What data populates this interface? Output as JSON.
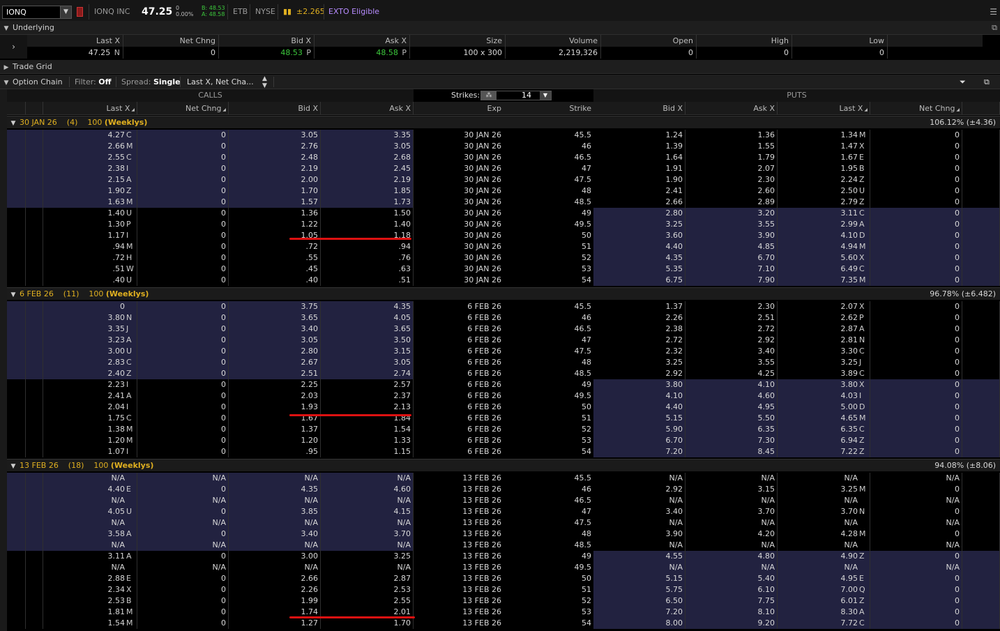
{
  "topbar": {
    "symbol": "IONQ",
    "name": "IONQ INC",
    "price": "47.25",
    "net_change": "0",
    "pct_change": "0.00%",
    "bid": "B: 48.53",
    "ask": "A: 48.58",
    "etb": "ETB",
    "exchange": "NYSE",
    "market_maker_move": "±2.265",
    "exto": "EXTO Eligible"
  },
  "underlying": {
    "title": "Underlying",
    "headers": [
      "Last X",
      "Net Chng",
      "Bid X",
      "Ask X",
      "Size",
      "Volume",
      "Open",
      "High",
      "Low"
    ],
    "last": "47.25",
    "last_ex": "N",
    "net_chng": "0",
    "bid": "48.53",
    "bid_ex": "P",
    "ask": "48.58",
    "ask_ex": "P",
    "size": "100 x 300",
    "volume": "2,219,326",
    "open": "0",
    "high": "0",
    "low": "0"
  },
  "trade_grid": {
    "title": "Trade Grid"
  },
  "option_chain": {
    "title": "Option Chain",
    "filter_label": "Filter:",
    "filter_value": "Off",
    "spread_label": "Spread:",
    "spread_value": "Single",
    "layout": "Last X, Net Cha...",
    "calls_label": "CALLS",
    "puts_label": "PUTS",
    "strikes_label": "Strikes:",
    "strikes_value": "14",
    "call_headers": [
      "Last X",
      "Net Chng",
      "Bid X",
      "Ask X"
    ],
    "mid_headers": [
      "Exp",
      "Strike"
    ],
    "put_headers": [
      "Bid X",
      "Ask X",
      "Last X",
      "Net Chng"
    ]
  },
  "groups": [
    {
      "exp": "30 JAN 26",
      "days": "(4)",
      "mult": "100",
      "tag": "(Weeklys)",
      "iv": "106.12% (±4.36)",
      "rows": [
        {
          "cl": "4.27",
          "cle": "C",
          "cn": "0",
          "cb": "3.05",
          "ca": "3.35",
          "k": "45.5",
          "pb": "1.24",
          "pa": "1.36",
          "pl": "1.34",
          "ple": "M",
          "pn": "0"
        },
        {
          "cl": "2.66",
          "cle": "M",
          "cn": "0",
          "cb": "2.76",
          "ca": "3.05",
          "k": "46",
          "pb": "1.39",
          "pa": "1.55",
          "pl": "1.47",
          "ple": "X",
          "pn": "0"
        },
        {
          "cl": "2.55",
          "cle": "C",
          "cn": "0",
          "cb": "2.48",
          "ca": "2.68",
          "k": "46.5",
          "pb": "1.64",
          "pa": "1.79",
          "pl": "1.67",
          "ple": "E",
          "pn": "0"
        },
        {
          "cl": "2.38",
          "cle": "I",
          "cn": "0",
          "cb": "2.19",
          "ca": "2.45",
          "k": "47",
          "pb": "1.91",
          "pa": "2.07",
          "pl": "1.95",
          "ple": "B",
          "pn": "0"
        },
        {
          "cl": "2.15",
          "cle": "A",
          "cn": "0",
          "cb": "2.00",
          "ca": "2.19",
          "k": "47.5",
          "pb": "1.90",
          "pa": "2.30",
          "pl": "2.24",
          "ple": "Z",
          "pn": "0"
        },
        {
          "cl": "1.90",
          "cle": "Z",
          "cn": "0",
          "cb": "1.70",
          "ca": "1.85",
          "k": "48",
          "pb": "2.41",
          "pa": "2.60",
          "pl": "2.50",
          "ple": "U",
          "pn": "0"
        },
        {
          "cl": "1.63",
          "cle": "M",
          "cn": "0",
          "cb": "1.57",
          "ca": "1.73",
          "k": "48.5",
          "pb": "2.66",
          "pa": "2.89",
          "pl": "2.79",
          "ple": "Z",
          "pn": "0"
        },
        {
          "cl": "1.40",
          "cle": "U",
          "cn": "0",
          "cb": "1.36",
          "ca": "1.50",
          "k": "49",
          "pb": "2.80",
          "pa": "3.20",
          "pl": "3.11",
          "ple": "C",
          "pn": "0"
        },
        {
          "cl": "1.30",
          "cle": "P",
          "cn": "0",
          "cb": "1.22",
          "ca": "1.40",
          "k": "49.5",
          "pb": "3.25",
          "pa": "3.55",
          "pl": "2.99",
          "ple": "A",
          "pn": "0"
        },
        {
          "cl": "1.17",
          "cle": "I",
          "cn": "0",
          "cb": "1.05",
          "ca": "1.18",
          "k": "50",
          "pb": "3.60",
          "pa": "3.90",
          "pl": "4.10",
          "ple": "D",
          "pn": "0"
        },
        {
          "cl": ".94",
          "cle": "M",
          "cn": "0",
          "cb": ".72",
          "ca": ".94",
          "k": "51",
          "pb": "4.40",
          "pa": "4.85",
          "pl": "4.94",
          "ple": "M",
          "pn": "0"
        },
        {
          "cl": ".72",
          "cle": "H",
          "cn": "0",
          "cb": ".55",
          "ca": ".76",
          "k": "52",
          "pb": "4.35",
          "pa": "6.70",
          "pl": "5.60",
          "ple": "X",
          "pn": "0"
        },
        {
          "cl": ".51",
          "cle": "W",
          "cn": "0",
          "cb": ".45",
          "ca": ".63",
          "k": "53",
          "pb": "5.35",
          "pa": "7.10",
          "pl": "6.49",
          "ple": "C",
          "pn": "0"
        },
        {
          "cl": ".40",
          "cle": "U",
          "cn": "0",
          "cb": ".40",
          "ca": ".51",
          "k": "54",
          "pb": "6.75",
          "pa": "7.90",
          "pl": "7.35",
          "ple": "M",
          "pn": "0"
        }
      ]
    },
    {
      "exp": "6 FEB 26",
      "days": "(11)",
      "mult": "100",
      "tag": "(Weeklys)",
      "iv": "96.78% (±6.482)",
      "rows": [
        {
          "cl": "0",
          "cle": "",
          "cn": "0",
          "cb": "3.75",
          "ca": "4.35",
          "k": "45.5",
          "pb": "1.37",
          "pa": "2.30",
          "pl": "2.07",
          "ple": "X",
          "pn": "0"
        },
        {
          "cl": "3.80",
          "cle": "N",
          "cn": "0",
          "cb": "3.65",
          "ca": "4.05",
          "k": "46",
          "pb": "2.26",
          "pa": "2.51",
          "pl": "2.62",
          "ple": "P",
          "pn": "0"
        },
        {
          "cl": "3.35",
          "cle": "J",
          "cn": "0",
          "cb": "3.40",
          "ca": "3.65",
          "k": "46.5",
          "pb": "2.38",
          "pa": "2.72",
          "pl": "2.87",
          "ple": "A",
          "pn": "0"
        },
        {
          "cl": "3.23",
          "cle": "A",
          "cn": "0",
          "cb": "3.05",
          "ca": "3.50",
          "k": "47",
          "pb": "2.72",
          "pa": "2.92",
          "pl": "2.81",
          "ple": "N",
          "pn": "0"
        },
        {
          "cl": "3.00",
          "cle": "U",
          "cn": "0",
          "cb": "2.80",
          "ca": "3.15",
          "k": "47.5",
          "pb": "2.32",
          "pa": "3.40",
          "pl": "3.30",
          "ple": "C",
          "pn": "0"
        },
        {
          "cl": "2.83",
          "cle": "C",
          "cn": "0",
          "cb": "2.67",
          "ca": "3.05",
          "k": "48",
          "pb": "3.25",
          "pa": "3.55",
          "pl": "3.25",
          "ple": "J",
          "pn": "0"
        },
        {
          "cl": "2.40",
          "cle": "Z",
          "cn": "0",
          "cb": "2.51",
          "ca": "2.74",
          "k": "48.5",
          "pb": "2.92",
          "pa": "4.25",
          "pl": "3.89",
          "ple": "C",
          "pn": "0"
        },
        {
          "cl": "2.23",
          "cle": "I",
          "cn": "0",
          "cb": "2.25",
          "ca": "2.57",
          "k": "49",
          "pb": "3.80",
          "pa": "4.10",
          "pl": "3.80",
          "ple": "X",
          "pn": "0"
        },
        {
          "cl": "2.41",
          "cle": "A",
          "cn": "0",
          "cb": "2.03",
          "ca": "2.37",
          "k": "49.5",
          "pb": "4.10",
          "pa": "4.60",
          "pl": "4.03",
          "ple": "I",
          "pn": "0"
        },
        {
          "cl": "2.04",
          "cle": "I",
          "cn": "0",
          "cb": "1.93",
          "ca": "2.13",
          "k": "50",
          "pb": "4.40",
          "pa": "4.95",
          "pl": "5.00",
          "ple": "D",
          "pn": "0"
        },
        {
          "cl": "1.75",
          "cle": "C",
          "cn": "0",
          "cb": "1.67",
          "ca": "1.84",
          "k": "51",
          "pb": "5.15",
          "pa": "5.50",
          "pl": "4.65",
          "ple": "M",
          "pn": "0"
        },
        {
          "cl": "1.38",
          "cle": "M",
          "cn": "0",
          "cb": "1.37",
          "ca": "1.54",
          "k": "52",
          "pb": "5.90",
          "pa": "6.35",
          "pl": "6.35",
          "ple": "C",
          "pn": "0"
        },
        {
          "cl": "1.20",
          "cle": "M",
          "cn": "0",
          "cb": "1.20",
          "ca": "1.33",
          "k": "53",
          "pb": "6.70",
          "pa": "7.30",
          "pl": "6.94",
          "ple": "Z",
          "pn": "0"
        },
        {
          "cl": "1.07",
          "cle": "I",
          "cn": "0",
          "cb": ".95",
          "ca": "1.15",
          "k": "54",
          "pb": "7.20",
          "pa": "8.45",
          "pl": "7.22",
          "ple": "Z",
          "pn": "0"
        }
      ]
    },
    {
      "exp": "13 FEB 26",
      "days": "(18)",
      "mult": "100",
      "tag": "(Weeklys)",
      "iv": "94.08% (±8.06)",
      "rows": [
        {
          "cl": "N/A",
          "cle": "",
          "cn": "N/A",
          "cb": "N/A",
          "ca": "N/A",
          "k": "45.5",
          "pb": "N/A",
          "pa": "N/A",
          "pl": "N/A",
          "ple": "",
          "pn": "N/A"
        },
        {
          "cl": "4.40",
          "cle": "E",
          "cn": "0",
          "cb": "4.35",
          "ca": "4.60",
          "k": "46",
          "pb": "2.92",
          "pa": "3.15",
          "pl": "3.25",
          "ple": "M",
          "pn": "0"
        },
        {
          "cl": "N/A",
          "cle": "",
          "cn": "N/A",
          "cb": "N/A",
          "ca": "N/A",
          "k": "46.5",
          "pb": "N/A",
          "pa": "N/A",
          "pl": "N/A",
          "ple": "",
          "pn": "N/A"
        },
        {
          "cl": "4.05",
          "cle": "U",
          "cn": "0",
          "cb": "3.85",
          "ca": "4.15",
          "k": "47",
          "pb": "3.40",
          "pa": "3.70",
          "pl": "3.70",
          "ple": "N",
          "pn": "0"
        },
        {
          "cl": "N/A",
          "cle": "",
          "cn": "N/A",
          "cb": "N/A",
          "ca": "N/A",
          "k": "47.5",
          "pb": "N/A",
          "pa": "N/A",
          "pl": "N/A",
          "ple": "",
          "pn": "N/A"
        },
        {
          "cl": "3.58",
          "cle": "A",
          "cn": "0",
          "cb": "3.40",
          "ca": "3.70",
          "k": "48",
          "pb": "3.90",
          "pa": "4.20",
          "pl": "4.28",
          "ple": "M",
          "pn": "0"
        },
        {
          "cl": "N/A",
          "cle": "",
          "cn": "N/A",
          "cb": "N/A",
          "ca": "N/A",
          "k": "48.5",
          "pb": "N/A",
          "pa": "N/A",
          "pl": "N/A",
          "ple": "",
          "pn": "N/A"
        },
        {
          "cl": "3.11",
          "cle": "A",
          "cn": "0",
          "cb": "3.00",
          "ca": "3.25",
          "k": "49",
          "pb": "4.55",
          "pa": "4.80",
          "pl": "4.90",
          "ple": "Z",
          "pn": "0"
        },
        {
          "cl": "N/A",
          "cle": "",
          "cn": "N/A",
          "cb": "N/A",
          "ca": "N/A",
          "k": "49.5",
          "pb": "N/A",
          "pa": "N/A",
          "pl": "N/A",
          "ple": "",
          "pn": "N/A"
        },
        {
          "cl": "2.88",
          "cle": "E",
          "cn": "0",
          "cb": "2.66",
          "ca": "2.87",
          "k": "50",
          "pb": "5.15",
          "pa": "5.40",
          "pl": "4.95",
          "ple": "E",
          "pn": "0"
        },
        {
          "cl": "2.34",
          "cle": "X",
          "cn": "0",
          "cb": "2.26",
          "ca": "2.53",
          "k": "51",
          "pb": "5.75",
          "pa": "6.10",
          "pl": "7.00",
          "ple": "Q",
          "pn": "0"
        },
        {
          "cl": "2.53",
          "cle": "B",
          "cn": "0",
          "cb": "1.99",
          "ca": "2.55",
          "k": "52",
          "pb": "6.50",
          "pa": "7.75",
          "pl": "6.01",
          "ple": "Z",
          "pn": "0"
        },
        {
          "cl": "1.81",
          "cle": "M",
          "cn": "0",
          "cb": "1.74",
          "ca": "2.01",
          "k": "53",
          "pb": "7.20",
          "pa": "8.10",
          "pl": "8.30",
          "ple": "A",
          "pn": "0"
        },
        {
          "cl": "1.54",
          "cle": "M",
          "cn": "0",
          "cb": "1.27",
          "ca": "1.70",
          "k": "54",
          "pb": "8.00",
          "pa": "9.20",
          "pl": "7.72",
          "ple": "C",
          "pn": "0"
        }
      ]
    }
  ],
  "colors": {
    "itm_bg": "#222240",
    "accent_gold": "#e0b020",
    "green": "#3cc83c",
    "exto_purple": "#b78cff",
    "annotation_red": "#d11111"
  }
}
